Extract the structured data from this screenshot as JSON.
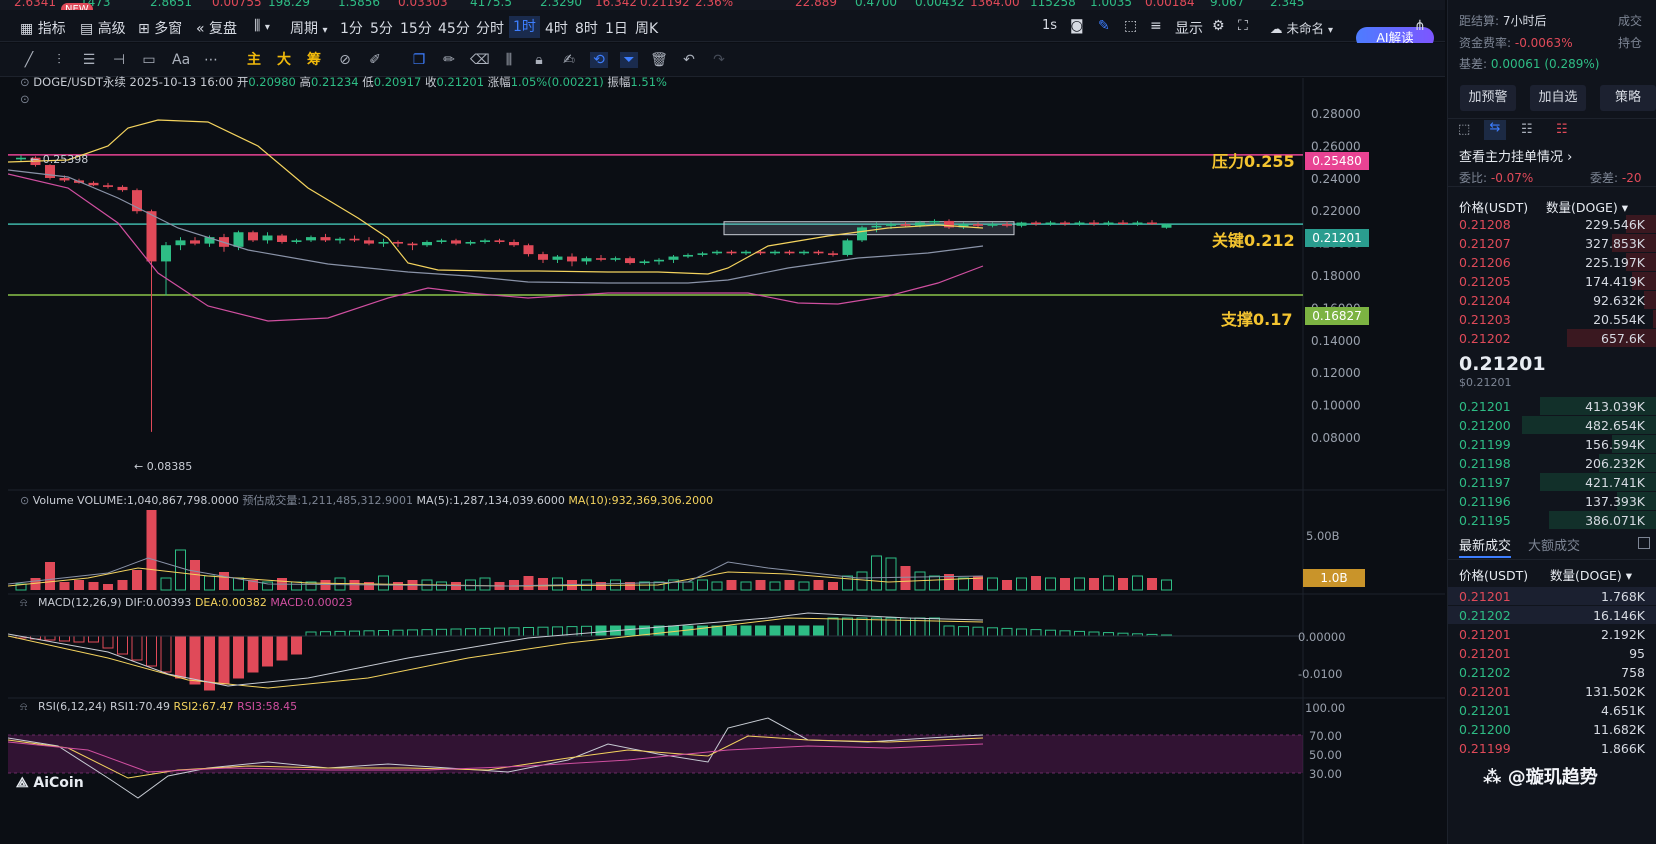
{
  "ticker": [
    "2.6341",
    "1473",
    "2.8651",
    "0.00755",
    "198.29",
    "1.5856",
    "0.03303",
    "4175.5",
    "2.3290",
    "16.342",
    "0.21192",
    "2.36%",
    "22.889",
    "0.4700",
    "0.00432",
    "1364.00",
    "115258",
    "1.0035",
    "0.00184",
    "9.067",
    "2.345"
  ],
  "new_badge": "NEW",
  "toolbar": {
    "indicator": "指标",
    "advanced": "高级",
    "multiwindow": "多窗",
    "replay": "复盘",
    "period": "周期",
    "intervals": [
      "1分",
      "5分",
      "15分",
      "45分",
      "分时",
      "1时",
      "4时",
      "8时",
      "1日",
      "周K"
    ],
    "active_interval": "1时",
    "refresh": "1s",
    "display": "显示",
    "layout_name": "未命名",
    "ai_button": "AI解读"
  },
  "drawing_tools": {
    "main": "主",
    "big": "大",
    "chip": "筹",
    "text_tool": "Aa"
  },
  "chart_info": {
    "symbol": "DOGE/USDT永续",
    "datetime": "2025-10-13 16:00",
    "open_label": "开",
    "open": "0.20980",
    "high_label": "高",
    "high": "0.21234",
    "low_label": "低",
    "low": "0.20917",
    "close_label": "收",
    "close": "0.21201",
    "change_label": "涨幅",
    "change": "1.05%(0.00221)",
    "amp_label": "振幅",
    "amp": "1.51%"
  },
  "levels": {
    "resistance_label": "压力0.255",
    "resistance_tag": "0.25480",
    "key_label": "关键0.212",
    "key_tag": "0.21201",
    "support_label": "支撑0.17",
    "support_tag": "0.16827",
    "high_marker": "0.25398",
    "low_marker": "← 0.08385"
  },
  "price_axis": [
    "0.28000",
    "0.26000",
    "0.24000",
    "0.22000",
    "0.20000",
    "0.18000",
    "0.16000",
    "0.14000",
    "0.12000",
    "0.10000",
    "0.08000"
  ],
  "volume_info": {
    "label": "Volume",
    "volume": "VOLUME:1,040,867,798.0000",
    "est": "预估成交量:1,211,485,312.9001",
    "ma5": "MA(5):1,287,134,039.6000",
    "ma10": "MA(10):932,369,306.2000",
    "axis_top": "5.00B",
    "tag": "1.0B"
  },
  "macd_info": {
    "label": "MACD(12,26,9)",
    "dif": "DIF:0.00393",
    "dea": "DEA:0.00382",
    "macd": "MACD:0.00023",
    "axis": [
      "0.00000",
      "-0.0100"
    ]
  },
  "rsi_info": {
    "label": "RSI(6,12,24)",
    "rsi1": "RSI1:70.49",
    "rsi2": "RSI2:67.47",
    "rsi3": "RSI3:58.45",
    "axis": [
      "100.00",
      "70.00",
      "50.00",
      "30.00"
    ]
  },
  "watermark": {
    "logo": "AiCoin",
    "brand": "璇玑趋势"
  },
  "colors": {
    "up": "#2ebd85",
    "down": "#e04a59",
    "resistance": "#e84393",
    "key": "#3fb6a8",
    "support": "#8bc34a",
    "boll_upper": "#f4d35e",
    "boll_mid": "#8a93a8",
    "boll_lower": "#d04fa0"
  },
  "right_panel": {
    "settlement_label": "距结算:",
    "settlement": "7小时后",
    "settlement_right": "成交",
    "funding_label": "资金费率:",
    "funding": "-0.0063%",
    "funding_right": "持仓",
    "basis_label": "基差:",
    "basis": "0.00061 (0.289%)",
    "buttons": [
      "加预警",
      "加自选",
      "策略"
    ],
    "orderbook_title": "查看主力挂单情况",
    "ratio_label": "委比:",
    "ratio": "-0.07%",
    "diff_label": "委差:",
    "diff": "-20",
    "col_price": "价格(USDT)",
    "col_qty": "数量(DOGE)",
    "asks": [
      {
        "price": "0.21208",
        "qty": "229.546K"
      },
      {
        "price": "0.21207",
        "qty": "327.853K"
      },
      {
        "price": "0.21206",
        "qty": "225.197K"
      },
      {
        "price": "0.21205",
        "qty": "174.419K"
      },
      {
        "price": "0.21204",
        "qty": "92.632K"
      },
      {
        "price": "0.21203",
        "qty": "20.554K"
      },
      {
        "price": "0.21202",
        "qty": "657.6K"
      }
    ],
    "last_price": "0.21201",
    "last_usd": "$0.21201",
    "bids": [
      {
        "price": "0.21201",
        "qty": "413.039K"
      },
      {
        "price": "0.21200",
        "qty": "482.654K"
      },
      {
        "price": "0.21199",
        "qty": "156.594K"
      },
      {
        "price": "0.21198",
        "qty": "206.232K"
      },
      {
        "price": "0.21197",
        "qty": "421.741K"
      },
      {
        "price": "0.21196",
        "qty": "137.393K"
      },
      {
        "price": "0.21195",
        "qty": "386.071K"
      }
    ],
    "trades_tab": "最新成交",
    "big_trades_tab": "大额成交",
    "trades": [
      {
        "price": "0.21201",
        "qty": "1.768K",
        "side": "down"
      },
      {
        "price": "0.21202",
        "qty": "16.146K",
        "side": "up"
      },
      {
        "price": "0.21201",
        "qty": "2.192K",
        "side": "down"
      },
      {
        "price": "0.21201",
        "qty": "95",
        "side": "down"
      },
      {
        "price": "0.21202",
        "qty": "758",
        "side": "up"
      },
      {
        "price": "0.21201",
        "qty": "131.502K",
        "side": "down"
      },
      {
        "price": "0.21201",
        "qty": "4.651K",
        "side": "up"
      },
      {
        "price": "0.21200",
        "qty": "11.682K",
        "side": "up"
      },
      {
        "price": "0.21199",
        "qty": "1.866K",
        "side": "down"
      }
    ]
  }
}
